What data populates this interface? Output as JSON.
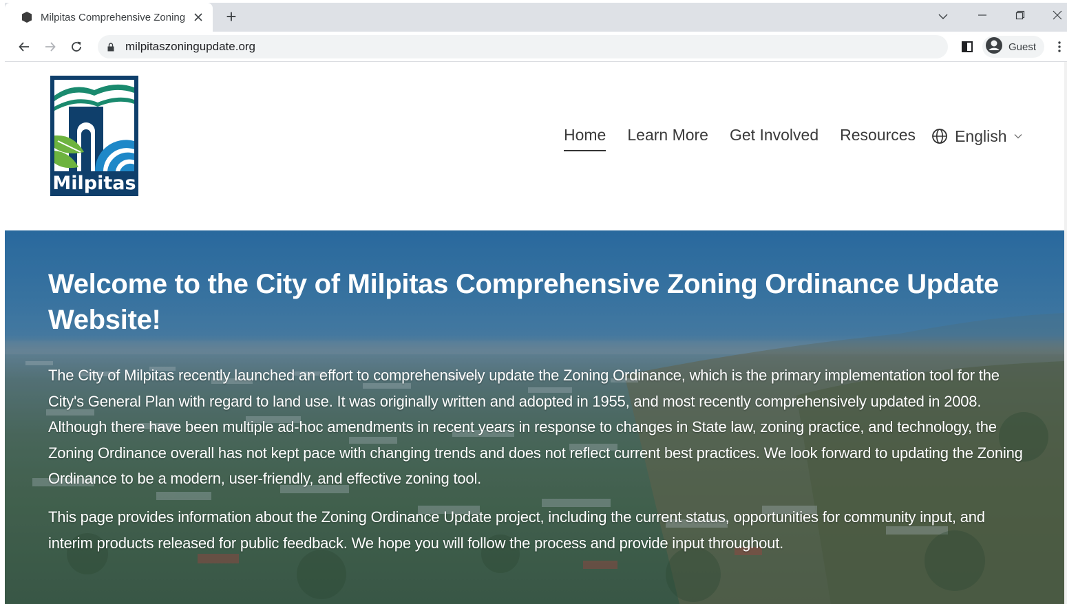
{
  "browser": {
    "tab_title": "Milpitas Comprehensive Zoning",
    "tab_close_icon": "close-icon",
    "new_tab_label": "+",
    "url": "milpitaszoningupdate.org",
    "profile_label": "Guest"
  },
  "site": {
    "logo_text": "Milpitas",
    "nav": [
      {
        "label": "Home",
        "active": true
      },
      {
        "label": "Learn More",
        "active": false
      },
      {
        "label": "Get Involved",
        "active": false
      },
      {
        "label": "Resources",
        "active": false
      }
    ],
    "language": "English"
  },
  "hero": {
    "title": "Welcome to the City of Milpitas Comprehensive Zoning Ordinance Update Website!",
    "paragraph_1": "The City of Milpitas recently launched an effort to comprehensively update the Zoning Ordinance, which is the primary implementation tool for the City's General Plan with regard to land use. It was originally written and adopted in 1955, and most recently comprehensively updated in 2008. Although there have been multiple ad-hoc amendments in recent years in response to changes in State law, zoning practice, and technology, the Zoning Ordinance overall has not kept pace with changing trends and does not reflect current best practices. We look forward to updating the Zoning Ordinance to be a modern, user-friendly, and effective zoning tool.",
    "paragraph_2": "This page provides information about the Zoning Ordinance Update project, including the current status, opportunities for community input, and interim products released for public feedback. We hope you will follow the process and provide input throughout."
  },
  "colors": {
    "logo_navy": "#0f3f6b",
    "logo_green": "#6db33f",
    "logo_blue": "#1e88c8",
    "hero_sky": "#2f78b3"
  }
}
